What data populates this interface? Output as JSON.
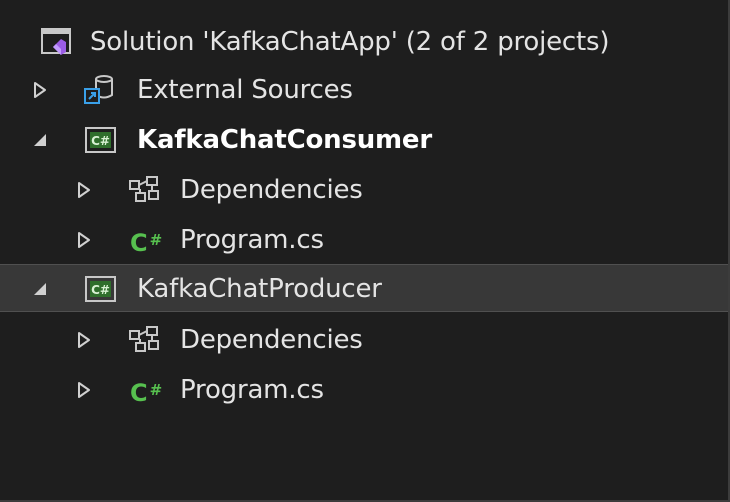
{
  "solution_explorer": {
    "solution": {
      "label": "Solution 'KafkaChatApp' (2 of 2 projects)",
      "icon": "visual-studio-solution-icon"
    },
    "external_sources": {
      "label": "External Sources",
      "icon": "database-link-icon",
      "expanded": false
    },
    "projects": [
      {
        "label": "KafkaChatConsumer",
        "icon": "csharp-project-icon",
        "expanded": true,
        "bold": true,
        "children": [
          {
            "label": "Dependencies",
            "icon": "dependencies-icon",
            "expanded": false
          },
          {
            "label": "Program.cs",
            "icon": "csharp-file-icon",
            "glyph": "C",
            "glyph_suffix": "#",
            "expanded": false
          }
        ]
      },
      {
        "label": "KafkaChatProducer",
        "icon": "csharp-project-icon",
        "expanded": true,
        "selected": true,
        "children": [
          {
            "label": "Dependencies",
            "icon": "dependencies-icon",
            "expanded": false
          },
          {
            "label": "Program.cs",
            "icon": "csharp-file-icon",
            "glyph": "C",
            "glyph_suffix": "#",
            "expanded": false
          }
        ]
      }
    ],
    "colors": {
      "background": "#1e1e1e",
      "selection": "#383838",
      "text": "#e4e4e4",
      "csharp_green": "#57c04f",
      "solution_purple": "#9b5de5",
      "database_blue": "#3aa0e8"
    }
  }
}
